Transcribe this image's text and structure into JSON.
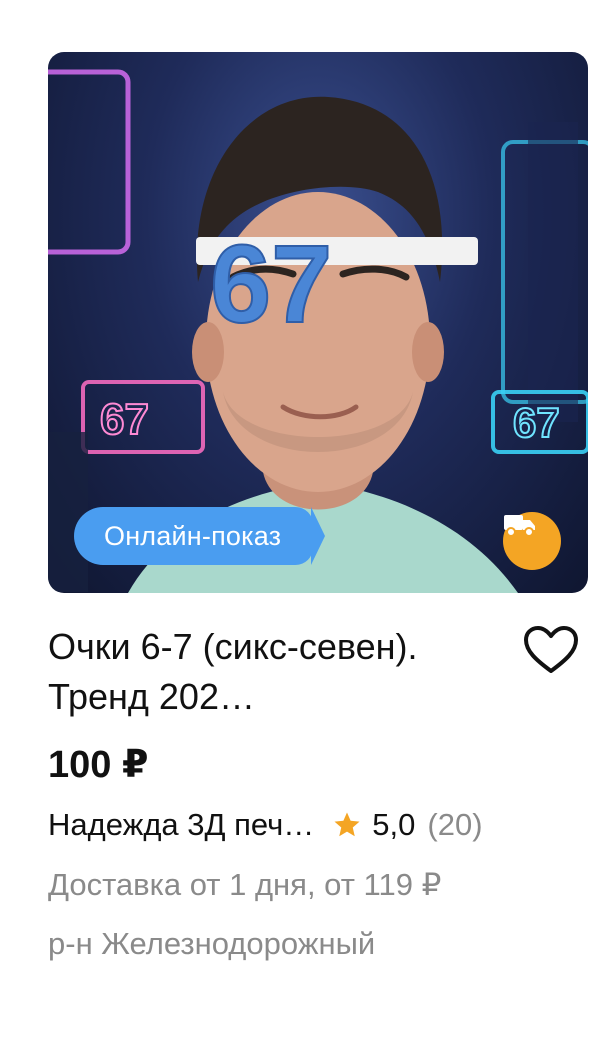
{
  "product": {
    "badge_label": "Онлайн-показ",
    "title": "Очки 6-7 (сикс-севен). Тренд 202…",
    "price": "100 ₽",
    "seller": "Надежда 3Д печ…",
    "rating": "5,0",
    "reviews": "(20)",
    "delivery": "Доставка от 1 дня, от 119 ₽",
    "district": "р-н Железнодорожный",
    "glasses_text": "67",
    "neon_sign_text": "67"
  },
  "icons": {
    "favorite": "heart-outline-icon",
    "delivery": "truck-icon",
    "rating": "star-icon"
  },
  "colors": {
    "badge": "#4a9df0",
    "delivery_badge": "#f4a524",
    "star": "#f4a524",
    "muted_text": "#8a8a8a",
    "glasses": "#4a86d6"
  }
}
